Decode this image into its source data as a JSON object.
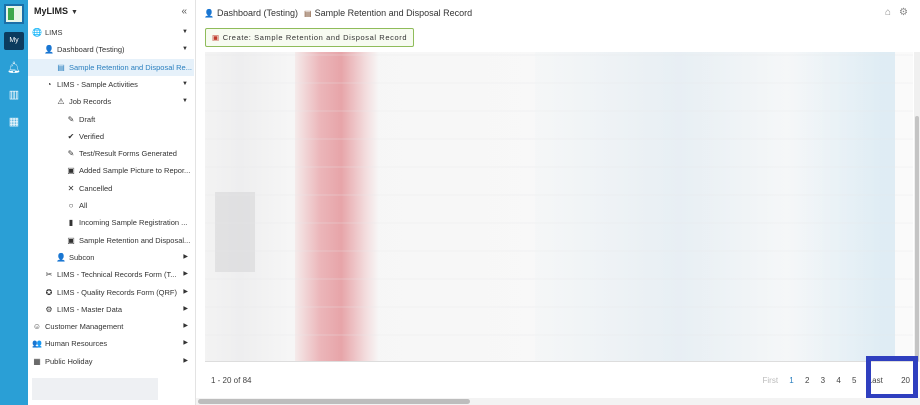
{
  "app": {
    "name": "MyLIMS",
    "rail_badge": "My"
  },
  "rail_icons": [
    "bell-icon",
    "bar-chart-icon",
    "calendar-icon"
  ],
  "sidebar": {
    "items": [
      {
        "label": "LIMS",
        "icon": "globe-icon",
        "glyph": "🌐",
        "expanded": true
      },
      {
        "label": "Dashboard (Testing)",
        "icon": "user-icon",
        "glyph": "👤",
        "expanded": true
      },
      {
        "label": "Sample Retention and Disposal Re...",
        "icon": "document-icon",
        "glyph": "▤",
        "selected": true
      },
      {
        "label": "LIMS - Sample Activities",
        "icon": "flask-icon",
        "glyph": "◔",
        "expanded": true
      },
      {
        "label": "Job Records",
        "icon": "warning-icon",
        "glyph": "⚠",
        "expanded": true
      },
      {
        "label": "Draft",
        "icon": "edit-icon",
        "glyph": "✎"
      },
      {
        "label": "Verified",
        "icon": "check-icon",
        "glyph": "✔"
      },
      {
        "label": "Test/Result Forms Generated",
        "icon": "pencil-icon",
        "glyph": "✎"
      },
      {
        "label": "Added Sample Picture to Repor...",
        "icon": "picture-icon",
        "glyph": "▣"
      },
      {
        "label": "Cancelled",
        "icon": "cross-icon",
        "glyph": "✕"
      },
      {
        "label": "All",
        "icon": "circle-icon",
        "glyph": "○"
      },
      {
        "label": "Incoming Sample Registration ...",
        "icon": "folder-icon",
        "glyph": "▮"
      },
      {
        "label": "Sample Retention and Disposal...",
        "icon": "picture-icon",
        "glyph": "▣"
      },
      {
        "label": "Subcon",
        "icon": "user-icon",
        "glyph": "👤",
        "collapsed": true
      },
      {
        "label": "LIMS - Technical Records Form (T...",
        "icon": "tools-icon",
        "glyph": "✂",
        "collapsed": true
      },
      {
        "label": "LIMS - Quality Records Form (QRF)",
        "icon": "badge-icon",
        "glyph": "✪",
        "collapsed": true
      },
      {
        "label": "LIMS - Master Data",
        "icon": "gear-icon",
        "glyph": "⚙",
        "collapsed": true
      },
      {
        "label": "Customer Management",
        "icon": "smiley-icon",
        "glyph": "☺",
        "collapsed": true
      },
      {
        "label": "Human Resources",
        "icon": "people-icon",
        "glyph": "👥",
        "collapsed": true
      },
      {
        "label": "Public Holiday",
        "icon": "calendar-icon",
        "glyph": "▦",
        "collapsed": true
      }
    ]
  },
  "breadcrumb": {
    "first": "Dashboard (Testing)",
    "second": "Sample Retention and Disposal Record"
  },
  "toolbar": {
    "create_label": "Create: Sample Retention and Disposal Record"
  },
  "pagination": {
    "range_text": "1 - 20 of 84",
    "first": "First",
    "pages": [
      "1",
      "2",
      "3",
      "4",
      "5"
    ],
    "current": "1",
    "last": "Last",
    "page_size": "20"
  },
  "colors": {
    "rail": "#2a9fd6",
    "accent": "#2a7fbf",
    "highlight_box": "#2f3fbf",
    "create_border": "#8fbc5a"
  }
}
